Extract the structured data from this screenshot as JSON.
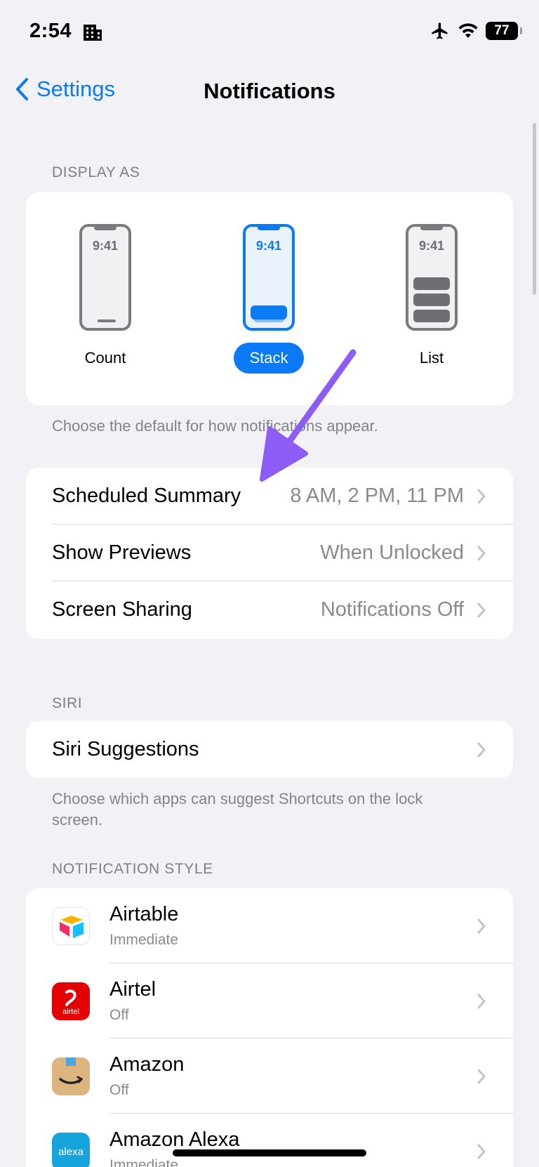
{
  "status_bar": {
    "time": "2:54",
    "battery": "77"
  },
  "nav": {
    "back_label": "Settings",
    "title": "Notifications"
  },
  "display_as": {
    "header": "DISPLAY AS",
    "options": [
      {
        "label": "Count",
        "phone_time": "9:41",
        "selected": false
      },
      {
        "label": "Stack",
        "phone_time": "9:41",
        "selected": true
      },
      {
        "label": "List",
        "phone_time": "9:41",
        "selected": false
      }
    ],
    "footer": "Choose the default for how notifications appear."
  },
  "settings_rows": [
    {
      "label": "Scheduled Summary",
      "value": "8 AM, 2 PM, 11 PM"
    },
    {
      "label": "Show Previews",
      "value": "When Unlocked"
    },
    {
      "label": "Screen Sharing",
      "value": "Notifications Off"
    }
  ],
  "siri": {
    "header": "SIRI",
    "row_label": "Siri Suggestions",
    "footer": "Choose which apps can suggest Shortcuts on the lock screen."
  },
  "notification_style": {
    "header": "NOTIFICATION STYLE",
    "apps": [
      {
        "name": "Airtable",
        "status": "Immediate",
        "icon": "airtable-icon"
      },
      {
        "name": "Airtel",
        "status": "Off",
        "icon": "airtel-icon",
        "icon_text": "airtel"
      },
      {
        "name": "Amazon",
        "status": "Off",
        "icon": "amazon-icon"
      },
      {
        "name": "Amazon Alexa",
        "status": "Immediate",
        "icon": "alexa-icon",
        "icon_text": "alexa"
      }
    ]
  },
  "colors": {
    "accent": "#0a7af6",
    "annotation_arrow": "#8b5cf6",
    "background": "#f2f1f6"
  }
}
